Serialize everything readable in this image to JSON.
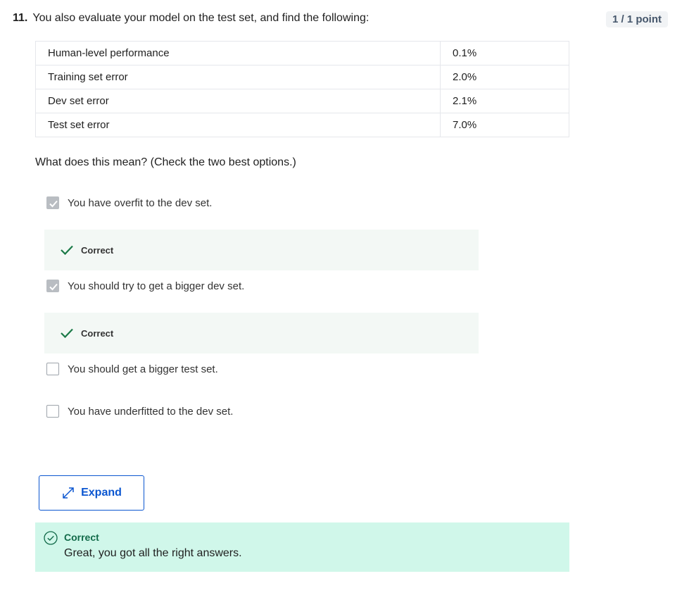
{
  "question": {
    "number": "11.",
    "text": "You also evaluate your model on the test set, and find the following:",
    "points": "1 / 1 point"
  },
  "table": {
    "rows": [
      {
        "label": "Human-level performance",
        "value": "0.1%"
      },
      {
        "label": "Training set error",
        "value": "2.0%"
      },
      {
        "label": "Dev set error",
        "value": "2.1%"
      },
      {
        "label": "Test set error",
        "value": "7.0%"
      }
    ]
  },
  "prompt": "What does this mean? (Check the two best options.)",
  "options": [
    {
      "label": "You have overfit to the dev set.",
      "checked": true,
      "feedback": "Correct"
    },
    {
      "label": "You should try to get a bigger dev set.",
      "checked": true,
      "feedback": "Correct"
    },
    {
      "label": "You should get a bigger test set.",
      "checked": false
    },
    {
      "label": "You have underfitted to the dev set.",
      "checked": false
    }
  ],
  "expand_label": "Expand",
  "result": {
    "title": "Correct",
    "message": "Great, you got all the right answers."
  },
  "colors": {
    "accent": "#0b56d0",
    "success": "#126b4a",
    "success_bg": "#d0f7ea",
    "feedback_bg": "#f3f8f5",
    "checkmark": "#1b7a48"
  }
}
